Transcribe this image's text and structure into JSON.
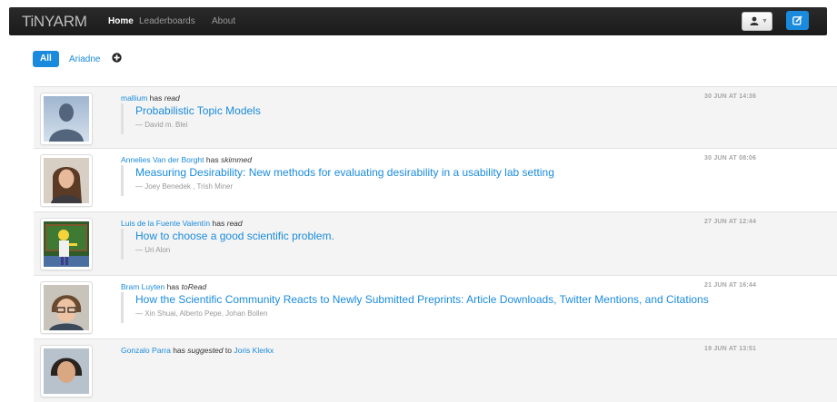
{
  "navbar": {
    "brand": "TiNYARM",
    "links": [
      {
        "label": "Home",
        "active": true
      },
      {
        "label": "Leaderboards",
        "active": false
      },
      {
        "label": "About",
        "active": false
      }
    ],
    "user_icon": "user-icon",
    "edit_icon": "edit-icon"
  },
  "filters": {
    "all_label": "All",
    "user_label": "Ariadne",
    "add_icon": "plus-circle-icon"
  },
  "colors": {
    "accent": "#1a8bdc",
    "navbar": "#1f1f1f"
  },
  "feed": [
    {
      "actor": "mallium",
      "verb": "has",
      "action": "read",
      "title": "Probabilistic Topic Models",
      "authors": "— David m. Blei",
      "timestamp": "30 JUN AT 14:36",
      "avatar": "default-avatar"
    },
    {
      "actor": "Annelies Van der Borght",
      "verb": "has",
      "action": "skimmed",
      "title": "Measuring Desirability: New methods for evaluating desirability in a usability lab setting",
      "authors": "— Joey Benedek , Trish Miner",
      "timestamp": "30 JUN AT 08:06",
      "avatar": "photo-avatar"
    },
    {
      "actor": "Luis de la Fuente Valentín",
      "verb": "has",
      "action": "read",
      "title": "How to choose a good scientific problem.",
      "authors": "— Uri Alon",
      "timestamp": "27 JUN AT 12:44",
      "avatar": "cartoon-avatar"
    },
    {
      "actor": "Bram Luyten",
      "verb": "has",
      "action": "toRead",
      "title": "How the Scientific Community Reacts to Newly Submitted Preprints: Article Downloads, Twitter Mentions, and Citations",
      "authors": "— Xin Shuai, Alberto Pepe, Johan Bollen",
      "timestamp": "21 JUN AT 16:44",
      "avatar": "photo-avatar"
    },
    {
      "actor": "Gonzalo Parra",
      "verb": "has",
      "action": "suggested",
      "preposition": "to",
      "target": "Joris Klerkx",
      "title": "",
      "authors": "",
      "timestamp": "19 JUN AT 13:51",
      "avatar": "photo-avatar"
    }
  ]
}
